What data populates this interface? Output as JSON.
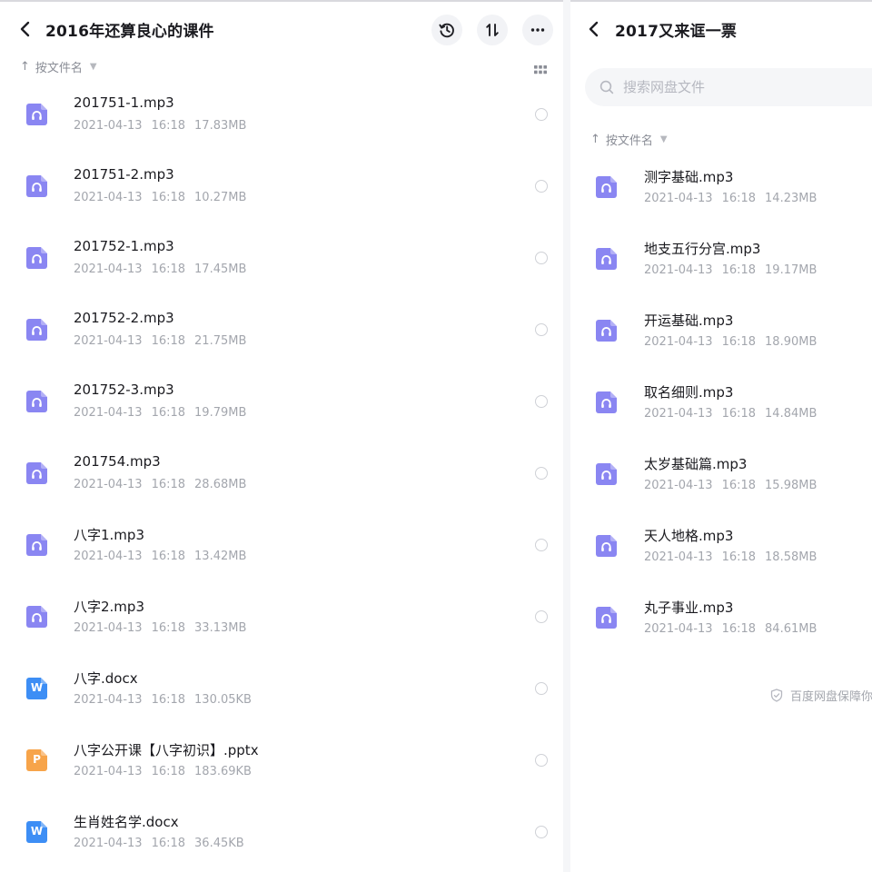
{
  "colors": {
    "audio_icon": "#8a86f2",
    "word_icon": "#3d8ef5",
    "ppt_icon": "#f7a44a"
  },
  "left_panel": {
    "title": "2016年还算良心的课件",
    "header_buttons": [
      "history-icon",
      "sort-toggle-icon",
      "more-icon"
    ],
    "sort_label": "按文件名",
    "files": [
      {
        "name": "201751-1.mp3",
        "date": "2021-04-13",
        "time": "16:18",
        "size": "17.83MB",
        "icon": "audio-file-icon",
        "letter": ""
      },
      {
        "name": "201751-2.mp3",
        "date": "2021-04-13",
        "time": "16:18",
        "size": "10.27MB",
        "icon": "audio-file-icon",
        "letter": ""
      },
      {
        "name": "201752-1.mp3",
        "date": "2021-04-13",
        "time": "16:18",
        "size": "17.45MB",
        "icon": "audio-file-icon",
        "letter": ""
      },
      {
        "name": "201752-2.mp3",
        "date": "2021-04-13",
        "time": "16:18",
        "size": "21.75MB",
        "icon": "audio-file-icon",
        "letter": ""
      },
      {
        "name": "201752-3.mp3",
        "date": "2021-04-13",
        "time": "16:18",
        "size": "19.79MB",
        "icon": "audio-file-icon",
        "letter": ""
      },
      {
        "name": "201754.mp3",
        "date": "2021-04-13",
        "time": "16:18",
        "size": "28.68MB",
        "icon": "audio-file-icon",
        "letter": ""
      },
      {
        "name": "八字1.mp3",
        "date": "2021-04-13",
        "time": "16:18",
        "size": "13.42MB",
        "icon": "audio-file-icon",
        "letter": ""
      },
      {
        "name": "八字2.mp3",
        "date": "2021-04-13",
        "time": "16:18",
        "size": "33.13MB",
        "icon": "audio-file-icon",
        "letter": ""
      },
      {
        "name": "八字.docx",
        "date": "2021-04-13",
        "time": "16:18",
        "size": "130.05KB",
        "icon": "word-file-icon",
        "letter": "W"
      },
      {
        "name": "八字公开课【八字初识】.pptx",
        "date": "2021-04-13",
        "time": "16:18",
        "size": "183.69KB",
        "icon": "ppt-file-icon",
        "letter": "P"
      },
      {
        "name": "生肖姓名学.docx",
        "date": "2021-04-13",
        "time": "16:18",
        "size": "36.45KB",
        "icon": "word-file-icon",
        "letter": "W"
      }
    ]
  },
  "right_panel": {
    "title": "2017又来诓一票",
    "search_placeholder": "搜索网盘文件",
    "sort_label": "按文件名",
    "files": [
      {
        "name": "测字基础.mp3",
        "date": "2021-04-13",
        "time": "16:18",
        "size": "14.23MB",
        "icon": "audio-file-icon",
        "letter": ""
      },
      {
        "name": "地支五行分宫.mp3",
        "date": "2021-04-13",
        "time": "16:18",
        "size": "19.17MB",
        "icon": "audio-file-icon",
        "letter": ""
      },
      {
        "name": "开运基础.mp3",
        "date": "2021-04-13",
        "time": "16:18",
        "size": "18.90MB",
        "icon": "audio-file-icon",
        "letter": ""
      },
      {
        "name": "取名细则.mp3",
        "date": "2021-04-13",
        "time": "16:18",
        "size": "14.84MB",
        "icon": "audio-file-icon",
        "letter": ""
      },
      {
        "name": "太岁基础篇.mp3",
        "date": "2021-04-13",
        "time": "16:18",
        "size": "15.98MB",
        "icon": "audio-file-icon",
        "letter": ""
      },
      {
        "name": "天人地格.mp3",
        "date": "2021-04-13",
        "time": "16:18",
        "size": "18.58MB",
        "icon": "audio-file-icon",
        "letter": ""
      },
      {
        "name": "丸子事业.mp3",
        "date": "2021-04-13",
        "time": "16:18",
        "size": "84.61MB",
        "icon": "audio-file-icon",
        "letter": ""
      }
    ],
    "footer_note": "百度网盘保障你"
  }
}
